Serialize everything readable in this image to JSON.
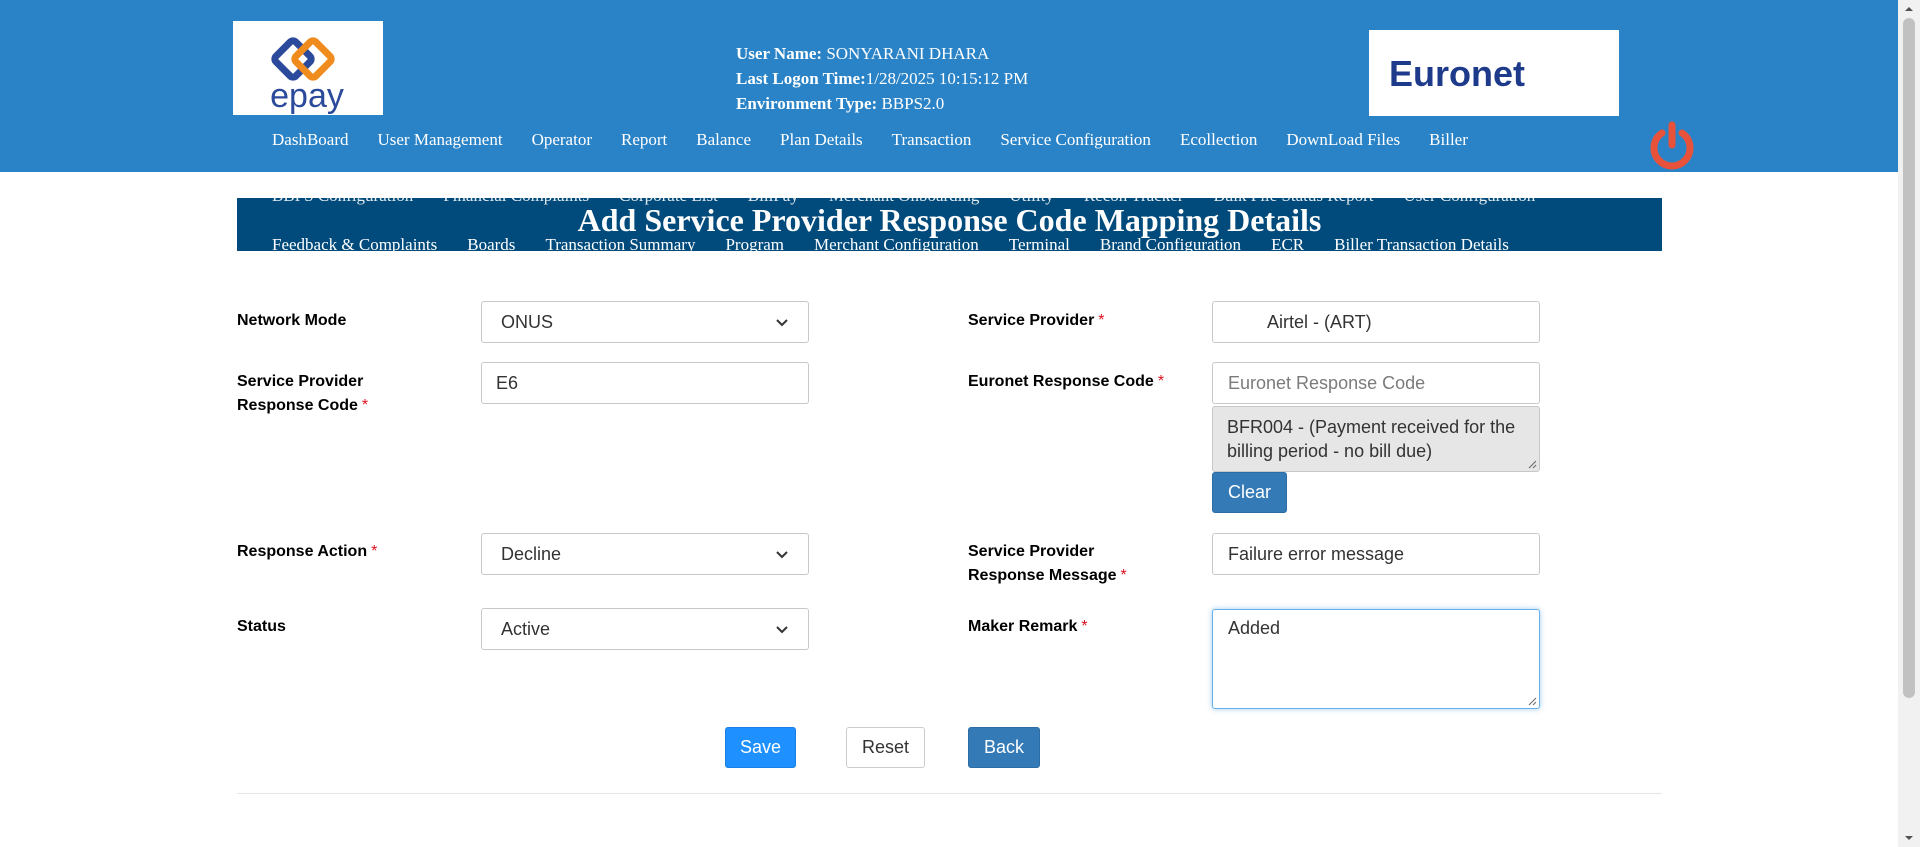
{
  "header": {
    "user_label": "User Name:",
    "user_value": "SONYARANI DHARA",
    "logon_label": "Last Logon Time:",
    "logon_value": "1/28/2025 10:15:12 PM",
    "env_label": "Environment Type:",
    "env_value": "BBPS2.0",
    "epay_logo_text": "epay",
    "euronet_logo_text": "Euronet"
  },
  "nav": {
    "items": [
      "DashBoard",
      "User Management",
      "Operator",
      "Report",
      "Balance",
      "Plan Details",
      "Transaction",
      "Service Configuration",
      "Ecollection",
      "DownLoad Files",
      "Biller"
    ]
  },
  "submenu": {
    "top_row": [
      "BBPS Configuration",
      "Financial Complaints",
      "Corporate List",
      "BillPay",
      "Merchant Onboarding",
      "Utility",
      "Recon Tracker",
      "Bulk File Status Report",
      "User Configuration"
    ],
    "bottom_row": [
      "Feedback & Complaints",
      "Boards",
      "Transaction Summary",
      "Program",
      "Merchant Configuration",
      "Terminal",
      "Brand Configuration",
      "ECR",
      "Biller Transaction Details"
    ]
  },
  "page": {
    "title": "Add Service Provider Response Code Mapping Details"
  },
  "form": {
    "network_mode_label": "Network Mode",
    "network_mode_value": "ONUS",
    "service_provider_label": "Service Provider",
    "service_provider_value": "Airtel - (ART)",
    "sp_response_code_label_1": "Service Provider",
    "sp_response_code_label_2": "Response Code",
    "sp_response_code_value": "E6",
    "euronet_response_code_label": "Euronet Response Code",
    "euronet_response_code_placeholder": "Euronet Response Code",
    "euronet_selected_text": "BFR004 - (Payment received for the billing period - no bill due)",
    "clear_label": "Clear",
    "response_action_label": "Response Action",
    "response_action_value": "Decline",
    "sp_response_message_label_1": "Service Provider",
    "sp_response_message_label_2": "Response Message",
    "sp_response_message_value": "Failure error message",
    "status_label": "Status",
    "status_value": "Active",
    "maker_remark_label": "Maker Remark",
    "maker_remark_value": "Added",
    "required_mark": "*"
  },
  "actions": {
    "save_label": "Save",
    "reset_label": "Reset",
    "back_label": "Back"
  },
  "colors": {
    "header_bg": "#2a83c6",
    "title_band_bg": "#004b7c",
    "power_icon": "#e8523a",
    "required": "#d9121c",
    "save_bg": "#1e90ff",
    "back_bg": "#337ab7"
  }
}
